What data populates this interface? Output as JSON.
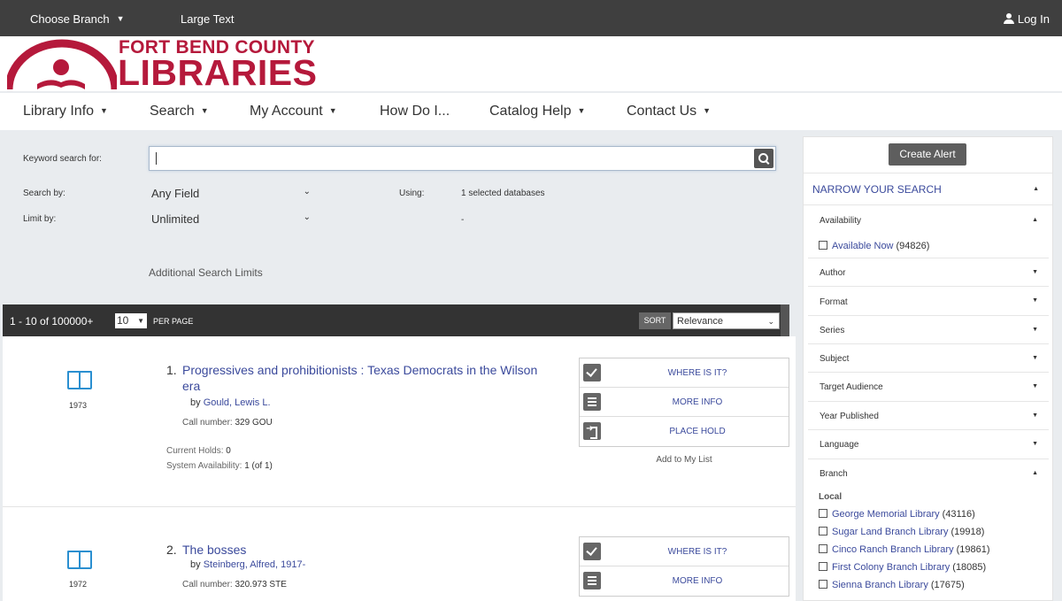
{
  "topbar": {
    "choose_branch": "Choose Branch",
    "large_text": "Large Text",
    "login": "Log In"
  },
  "logo": {
    "line1": "FORT BEND COUNTY",
    "line2": "LIBRARIES",
    "brand_color": "#b5193b"
  },
  "nav": {
    "items": [
      "Library Info",
      "Search",
      "My Account",
      "How Do I...",
      "Catalog Help",
      "Contact Us"
    ]
  },
  "search": {
    "keyword_label": "Keyword search for:",
    "keyword_value": "",
    "search_by_label": "Search by:",
    "search_by_value": "Any Field",
    "using_label": "Using:",
    "using_value": "1 selected databases",
    "limit_by_label": "Limit by:",
    "limit_by_value": "Unlimited",
    "limit_extra": "-",
    "additional_limits": "Additional Search Limits"
  },
  "results_bar": {
    "count": "1 - 10 of 100000+",
    "per_page_value": "10",
    "per_page_label": "PER PAGE",
    "sort_label": "SORT",
    "sort_value": "Relevance"
  },
  "results": [
    {
      "num": "1.",
      "title": "Progressives and prohibitionists : Texas Democrats in the Wilson era",
      "by_label": "by",
      "author": "Gould, Lewis L.",
      "call_label": "Call number:",
      "call_number": "329 GOU",
      "year": "1973",
      "holds_label": "Current Holds:",
      "holds": "0",
      "avail_label": "System Availability:",
      "availability": "1 (of 1)",
      "actions": [
        "WHERE IS IT?",
        "MORE INFO",
        "PLACE HOLD"
      ],
      "add_to_list": "Add to My List"
    },
    {
      "num": "2.",
      "title": "The bosses",
      "by_label": "by",
      "author": "Steinberg, Alfred, 1917-",
      "call_label": "Call number:",
      "call_number": "320.973 STE",
      "year": "1972",
      "actions": [
        "WHERE IS IT?",
        "MORE INFO"
      ]
    }
  ],
  "sidebar": {
    "create_alert": "Create Alert",
    "narrow_heading": "NARROW YOUR SEARCH",
    "availability": {
      "label": "Availability",
      "option": "Available Now",
      "count": "(94826)"
    },
    "facets": [
      "Author",
      "Format",
      "Series",
      "Subject",
      "Target Audience",
      "Year Published",
      "Language"
    ],
    "branch": {
      "label": "Branch",
      "local_label": "Local",
      "options": [
        {
          "name": "George Memorial Library",
          "count": "(43116)"
        },
        {
          "name": "Sugar Land Branch Library",
          "count": "(19918)"
        },
        {
          "name": "Cinco Ranch Branch Library",
          "count": "(19861)"
        },
        {
          "name": "First Colony Branch Library",
          "count": "(18085)"
        },
        {
          "name": "Sienna Branch Library",
          "count": "(17675)"
        }
      ]
    }
  }
}
